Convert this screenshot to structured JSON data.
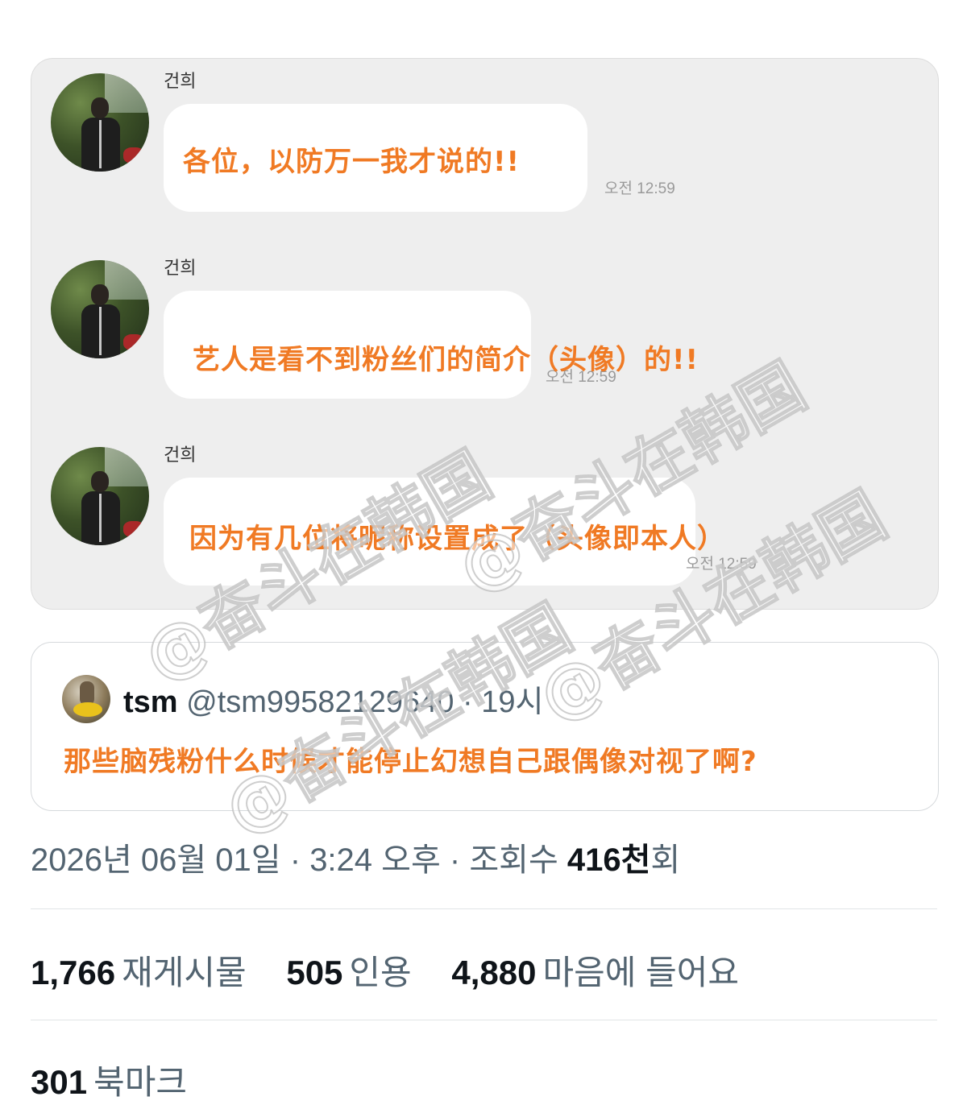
{
  "chat": {
    "messages": [
      {
        "sender": "건희",
        "text": "各位，以防万一我才说的!!",
        "time": "오전 12:59"
      },
      {
        "sender": "건희",
        "text": "艺人是看不到粉丝们的简介（头像）的!!",
        "time": "오전 12:59"
      },
      {
        "sender": "건희",
        "text": "因为有几位将昵称设置成了（头像即本人）",
        "time": "오전 12:59"
      }
    ]
  },
  "quote": {
    "name": "tsm",
    "handle": "@tsm99582129640",
    "separator": "·",
    "time": "19시",
    "text": "那些脑残粉什么时候才能停止幻想自己跟偶像对视了啊?"
  },
  "post_meta": {
    "date": "2026년 06월 01일",
    "separator": "·",
    "time": "3:24 오후",
    "views_label": "조회수",
    "views_count": "416천",
    "views_suffix": "회"
  },
  "stats": {
    "reposts": {
      "count": "1,766",
      "label": "재게시물"
    },
    "quotes": {
      "count": "505",
      "label": "인용"
    },
    "likes": {
      "count": "4,880",
      "label": "마음에 들어요"
    },
    "bookmarks": {
      "count": "301",
      "label": "북마크"
    }
  },
  "watermark": {
    "text": "@奋斗在韩国"
  },
  "colors": {
    "annotation": "#f07a24",
    "card_bg": "#eeeeee",
    "secondary_text": "#536471"
  }
}
